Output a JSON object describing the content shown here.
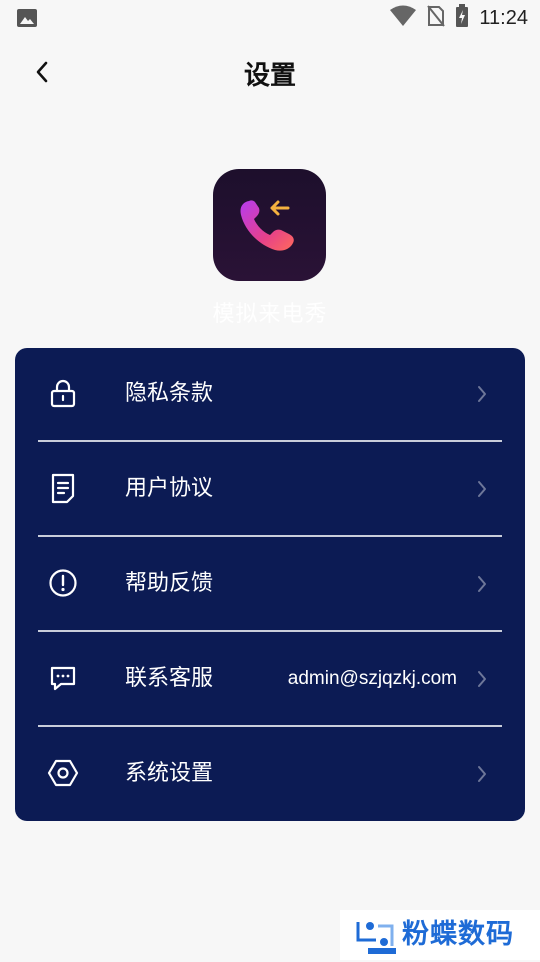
{
  "status_bar": {
    "time": "11:24",
    "icons": [
      "image-icon",
      "wifi-icon",
      "no-sim-icon",
      "battery-charging-icon"
    ]
  },
  "header": {
    "back_icon": "chevron-left-icon",
    "title": "设置"
  },
  "app": {
    "name": "模拟来电秀",
    "logo_icon": "incoming-call-icon"
  },
  "menu": {
    "background_color": "#0c1b54",
    "items": [
      {
        "icon": "lock-icon",
        "label": "隐私条款",
        "value": ""
      },
      {
        "icon": "document-icon",
        "label": "用户协议",
        "value": ""
      },
      {
        "icon": "exclamation-circle-icon",
        "label": "帮助反馈",
        "value": ""
      },
      {
        "icon": "chat-bubble-icon",
        "label": "联系客服",
        "value": "admin@szjqzkj.com"
      },
      {
        "icon": "hexagon-settings-icon",
        "label": "系统设置",
        "value": ""
      }
    ]
  },
  "watermark": {
    "text": "粉蝶数码",
    "color": "#1e6bd6"
  }
}
